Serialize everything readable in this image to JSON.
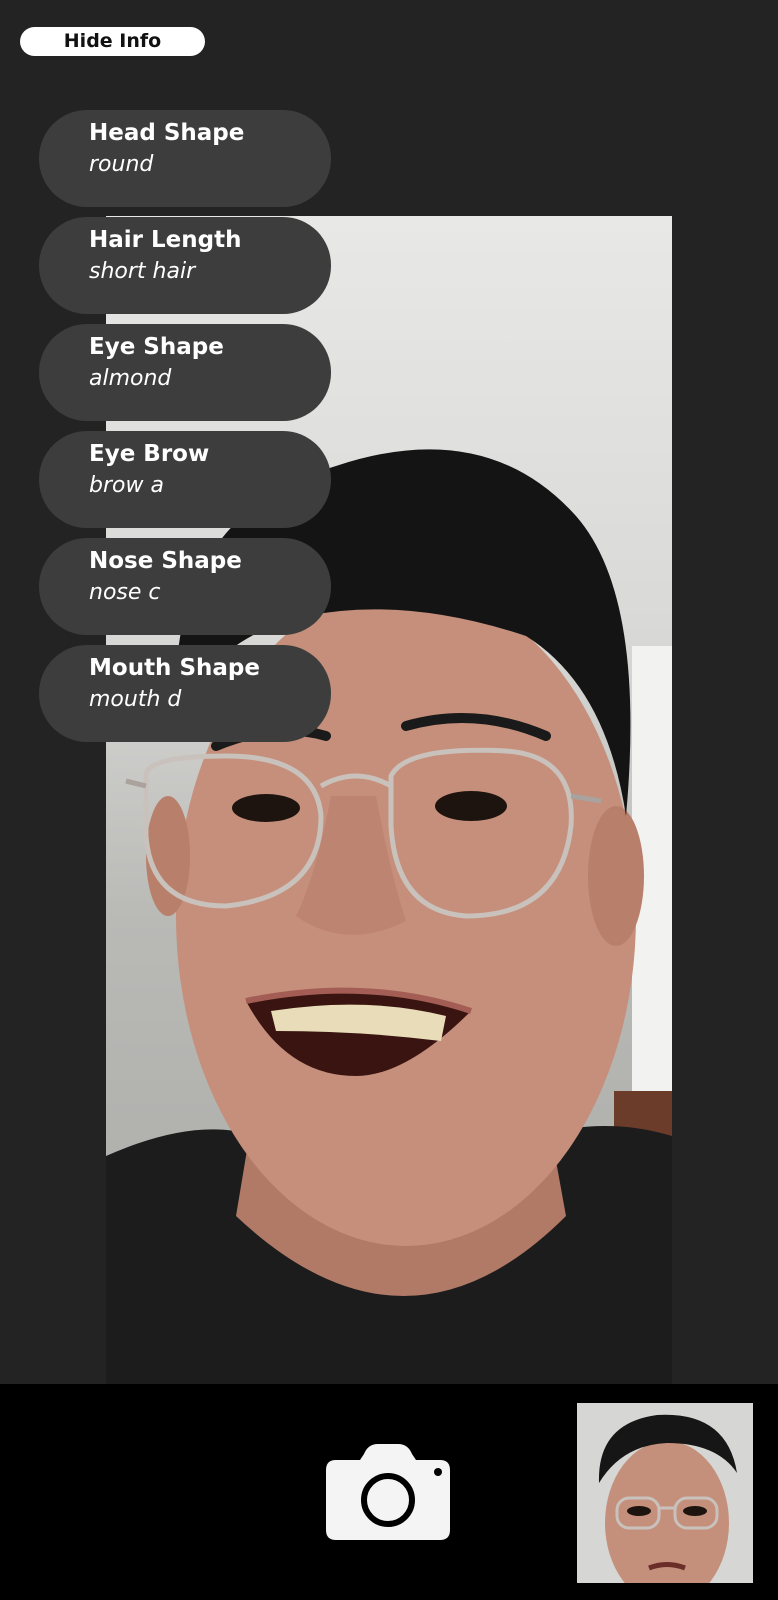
{
  "toggle": {
    "label": "Hide Info"
  },
  "features": [
    {
      "title": "Head Shape",
      "value": "round"
    },
    {
      "title": "Hair Length",
      "value": "short hair"
    },
    {
      "title": "Eye Shape",
      "value": "almond"
    },
    {
      "title": "Eye Brow",
      "value": "brow a"
    },
    {
      "title": "Nose Shape",
      "value": "nose c"
    },
    {
      "title": "Mouth Shape",
      "value": "mouth d"
    }
  ],
  "icons": {
    "shutter": "camera-icon"
  },
  "colors": {
    "background": "#232323",
    "pill": "#3d3d3d",
    "bottom_bar": "#000000",
    "text": "#ffffff"
  }
}
